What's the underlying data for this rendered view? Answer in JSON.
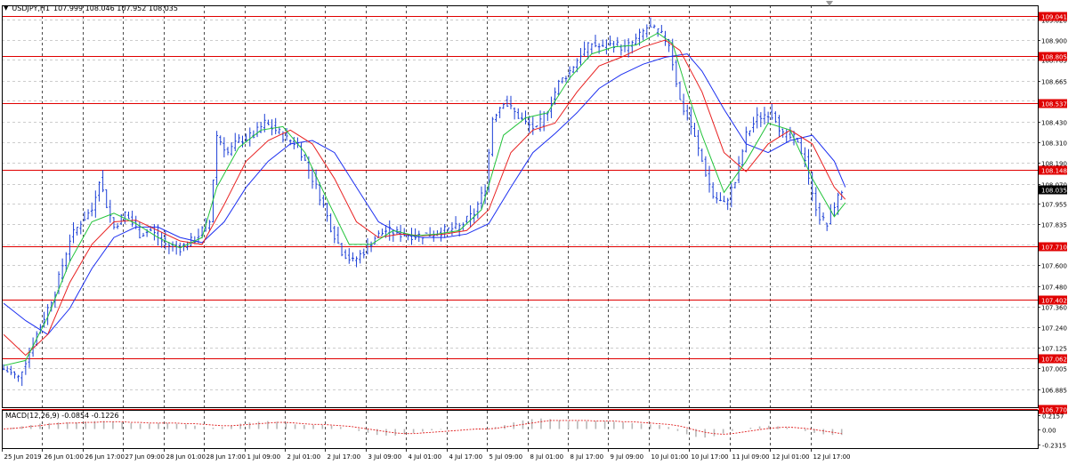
{
  "window": {
    "menu_icon": "triangle-down-icon",
    "symbol": "USDJPY,H1",
    "ohlc": "107.999 108.046 107.952 108.035"
  },
  "macd": {
    "label": "MACD(12,26,9) -0.0854 -0.1226",
    "ticks": [
      "0.2157",
      "0.00",
      "-0.2315"
    ],
    "tick_values": [
      0.2157,
      0.0,
      -0.2315
    ],
    "ylim": [
      -0.29,
      0.29
    ],
    "histogram": [
      0.0,
      0.02,
      0.04,
      0.06,
      0.08,
      0.09,
      0.1,
      0.1,
      0.1,
      0.11,
      0.12,
      0.12,
      0.11,
      0.1,
      0.09,
      0.08,
      0.08,
      0.09,
      0.09,
      0.08,
      0.07,
      0.05,
      0.03,
      0.02,
      0.03,
      0.05,
      0.08,
      0.1,
      0.11,
      0.12,
      0.11,
      0.09,
      0.07,
      0.06,
      0.06,
      0.06,
      0.05,
      0.03,
      0.0,
      -0.03,
      -0.06,
      -0.09,
      -0.1,
      -0.1,
      -0.08,
      -0.06,
      -0.04,
      -0.02,
      -0.01,
      0.0,
      0.0,
      0.0,
      0.0,
      0.01,
      0.03,
      0.06,
      0.1,
      0.13,
      0.15,
      0.16,
      0.15,
      0.13,
      0.12,
      0.12,
      0.12,
      0.12,
      0.12,
      0.11,
      0.1,
      0.09,
      0.08,
      0.07,
      0.06,
      0.03,
      -0.03,
      -0.08,
      -0.12,
      -0.13,
      -0.11,
      -0.07,
      -0.03,
      0.0,
      0.02,
      0.04,
      0.05,
      0.04,
      0.02,
      0.0,
      -0.03,
      -0.06,
      -0.08,
      -0.09,
      -0.09
    ],
    "signal": [
      0.0,
      0.01,
      0.02,
      0.04,
      0.05,
      0.07,
      0.08,
      0.09,
      0.09,
      0.1,
      0.1,
      0.11,
      0.11,
      0.11,
      0.1,
      0.1,
      0.09,
      0.09,
      0.09,
      0.09,
      0.08,
      0.08,
      0.07,
      0.06,
      0.05,
      0.05,
      0.06,
      0.07,
      0.08,
      0.09,
      0.1,
      0.1,
      0.09,
      0.08,
      0.07,
      0.07,
      0.06,
      0.05,
      0.04,
      0.02,
      0.0,
      -0.02,
      -0.04,
      -0.06,
      -0.07,
      -0.07,
      -0.06,
      -0.05,
      -0.04,
      -0.03,
      -0.02,
      -0.01,
      0.0,
      0.0,
      0.01,
      0.03,
      0.05,
      0.07,
      0.09,
      0.11,
      0.13,
      0.13,
      0.13,
      0.13,
      0.13,
      0.12,
      0.12,
      0.12,
      0.11,
      0.11,
      0.1,
      0.09,
      0.08,
      0.07,
      0.05,
      0.02,
      -0.02,
      -0.05,
      -0.07,
      -0.08,
      -0.07,
      -0.05,
      -0.03,
      -0.01,
      0.01,
      0.02,
      0.03,
      0.02,
      0.01,
      -0.01,
      -0.03,
      -0.05,
      -0.07
    ]
  },
  "chart_data": {
    "type": "candlestick",
    "symbol": "USDJPY",
    "timeframe": "H1",
    "ylim": [
      106.78,
      109.1
    ],
    "yticks": [
      "109.020",
      "108.900",
      "108.785",
      "108.665",
      "108.550",
      "108.430",
      "108.310",
      "108.190",
      "108.070",
      "107.955",
      "107.835",
      "107.720",
      "107.600",
      "107.480",
      "107.360",
      "107.240",
      "107.125",
      "107.005",
      "106.885"
    ],
    "ytick_values": [
      109.02,
      108.9,
      108.785,
      108.665,
      108.55,
      108.43,
      108.31,
      108.19,
      108.07,
      107.955,
      107.835,
      107.72,
      107.6,
      107.48,
      107.36,
      107.24,
      107.125,
      107.005,
      106.885
    ],
    "xticks": [
      "25 Jun 2019",
      "26 Jun 01:00",
      "26 Jun 17:00",
      "27 Jun 09:00",
      "28 Jun 01:00",
      "28 Jun 17:00",
      "1 Jul 09:00",
      "2 Jul 01:00",
      "2 Jul 17:00",
      "3 Jul 09:00",
      "4 Jul 01:00",
      "4 Jul 17:00",
      "5 Jul 09:00",
      "8 Jul 01:00",
      "8 Jul 17:00",
      "9 Jul 09:00",
      "10 Jul 01:00",
      "10 Jul 17:00",
      "11 Jul 09:00",
      "12 Jul 01:00",
      "12 Jul 17:00"
    ],
    "xtick_bars": [
      0,
      11,
      22,
      33,
      44,
      55,
      66,
      77,
      88,
      99,
      110,
      121,
      132,
      143,
      154,
      165,
      176,
      187,
      198,
      209,
      220
    ],
    "bar_count": 229,
    "horizontal_levels": [
      {
        "value": 109.04,
        "label": "109.041"
      },
      {
        "value": 108.805,
        "label": "108.805"
      },
      {
        "value": 108.537,
        "label": "108.537"
      },
      {
        "value": 108.148,
        "label": "108.148"
      },
      {
        "value": 107.71,
        "label": "107.710"
      },
      {
        "value": 107.402,
        "label": "107.402"
      },
      {
        "value": 107.062,
        "label": "107.062"
      },
      {
        "value": 106.77,
        "label": "106.770"
      }
    ],
    "current_price": {
      "value": 108.035,
      "label": "108.035"
    },
    "price_path": [
      [
        0,
        107.0
      ],
      [
        4,
        106.95
      ],
      [
        8,
        107.15
      ],
      [
        11,
        107.3
      ],
      [
        14,
        107.45
      ],
      [
        18,
        107.75
      ],
      [
        21,
        107.85
      ],
      [
        24,
        107.92
      ],
      [
        26,
        108.1
      ],
      [
        28,
        107.95
      ],
      [
        30,
        107.82
      ],
      [
        33,
        107.9
      ],
      [
        37,
        107.78
      ],
      [
        40,
        107.8
      ],
      [
        44,
        107.72
      ],
      [
        48,
        107.7
      ],
      [
        52,
        107.75
      ],
      [
        56,
        107.85
      ],
      [
        58,
        108.35
      ],
      [
        61,
        108.25
      ],
      [
        64,
        108.32
      ],
      [
        68,
        108.35
      ],
      [
        71,
        108.42
      ],
      [
        74,
        108.38
      ],
      [
        77,
        108.33
      ],
      [
        80,
        108.3
      ],
      [
        83,
        108.15
      ],
      [
        86,
        108.0
      ],
      [
        89,
        107.82
      ],
      [
        92,
        107.68
      ],
      [
        95,
        107.62
      ],
      [
        98,
        107.68
      ],
      [
        101,
        107.76
      ],
      [
        104,
        107.8
      ],
      [
        108,
        107.78
      ],
      [
        112,
        107.77
      ],
      [
        116,
        107.78
      ],
      [
        120,
        107.8
      ],
      [
        124,
        107.82
      ],
      [
        128,
        107.9
      ],
      [
        131,
        108.05
      ],
      [
        133,
        108.45
      ],
      [
        136,
        108.55
      ],
      [
        139,
        108.48
      ],
      [
        142,
        108.42
      ],
      [
        145,
        108.38
      ],
      [
        148,
        108.5
      ],
      [
        151,
        108.65
      ],
      [
        154,
        108.72
      ],
      [
        157,
        108.82
      ],
      [
        160,
        108.88
      ],
      [
        163,
        108.85
      ],
      [
        166,
        108.88
      ],
      [
        169,
        108.85
      ],
      [
        172,
        108.9
      ],
      [
        175,
        108.97
      ],
      [
        178,
        108.95
      ],
      [
        181,
        108.88
      ],
      [
        184,
        108.55
      ],
      [
        187,
        108.4
      ],
      [
        190,
        108.2
      ],
      [
        193,
        108.0
      ],
      [
        196,
        107.95
      ],
      [
        199,
        108.08
      ],
      [
        202,
        108.35
      ],
      [
        205,
        108.45
      ],
      [
        208,
        108.48
      ],
      [
        210,
        108.45
      ],
      [
        212,
        108.35
      ],
      [
        215,
        108.33
      ],
      [
        218,
        108.22
      ],
      [
        220,
        108.0
      ],
      [
        222,
        107.88
      ],
      [
        224,
        107.83
      ],
      [
        226,
        107.95
      ],
      [
        228,
        108.03
      ]
    ],
    "ma_fast_path": [
      [
        0,
        107.02
      ],
      [
        6,
        107.05
      ],
      [
        12,
        107.3
      ],
      [
        18,
        107.62
      ],
      [
        24,
        107.85
      ],
      [
        30,
        107.9
      ],
      [
        36,
        107.84
      ],
      [
        42,
        107.76
      ],
      [
        48,
        107.7
      ],
      [
        54,
        107.76
      ],
      [
        58,
        108.05
      ],
      [
        64,
        108.28
      ],
      [
        70,
        108.38
      ],
      [
        76,
        108.4
      ],
      [
        82,
        108.25
      ],
      [
        88,
        107.98
      ],
      [
        94,
        107.72
      ],
      [
        100,
        107.72
      ],
      [
        106,
        107.8
      ],
      [
        112,
        107.77
      ],
      [
        118,
        107.78
      ],
      [
        124,
        107.8
      ],
      [
        130,
        107.92
      ],
      [
        136,
        108.35
      ],
      [
        142,
        108.45
      ],
      [
        148,
        108.48
      ],
      [
        154,
        108.68
      ],
      [
        160,
        108.82
      ],
      [
        166,
        108.86
      ],
      [
        172,
        108.87
      ],
      [
        178,
        108.94
      ],
      [
        182,
        108.88
      ],
      [
        186,
        108.6
      ],
      [
        190,
        108.35
      ],
      [
        196,
        108.02
      ],
      [
        202,
        108.2
      ],
      [
        208,
        108.42
      ],
      [
        214,
        108.38
      ],
      [
        220,
        108.1
      ],
      [
        226,
        107.88
      ],
      [
        229,
        107.96
      ]
    ],
    "ma_mid_path": [
      [
        0,
        107.2
      ],
      [
        6,
        107.08
      ],
      [
        12,
        107.2
      ],
      [
        18,
        107.5
      ],
      [
        24,
        107.72
      ],
      [
        30,
        107.85
      ],
      [
        36,
        107.86
      ],
      [
        42,
        107.8
      ],
      [
        48,
        107.74
      ],
      [
        54,
        107.72
      ],
      [
        60,
        107.95
      ],
      [
        66,
        108.2
      ],
      [
        72,
        108.32
      ],
      [
        78,
        108.38
      ],
      [
        84,
        108.3
      ],
      [
        90,
        108.1
      ],
      [
        96,
        107.85
      ],
      [
        102,
        107.76
      ],
      [
        108,
        107.78
      ],
      [
        114,
        107.77
      ],
      [
        120,
        107.78
      ],
      [
        126,
        107.8
      ],
      [
        132,
        107.92
      ],
      [
        138,
        108.25
      ],
      [
        144,
        108.38
      ],
      [
        150,
        108.42
      ],
      [
        156,
        108.6
      ],
      [
        162,
        108.75
      ],
      [
        168,
        108.8
      ],
      [
        174,
        108.86
      ],
      [
        180,
        108.9
      ],
      [
        184,
        108.84
      ],
      [
        190,
        108.6
      ],
      [
        196,
        108.25
      ],
      [
        202,
        108.14
      ],
      [
        208,
        108.3
      ],
      [
        214,
        108.38
      ],
      [
        220,
        108.3
      ],
      [
        226,
        108.05
      ],
      [
        229,
        107.98
      ]
    ],
    "ma_slow_path": [
      [
        0,
        107.38
      ],
      [
        6,
        107.28
      ],
      [
        12,
        107.2
      ],
      [
        18,
        107.35
      ],
      [
        24,
        107.58
      ],
      [
        30,
        107.76
      ],
      [
        36,
        107.82
      ],
      [
        42,
        107.82
      ],
      [
        48,
        107.76
      ],
      [
        54,
        107.73
      ],
      [
        60,
        107.85
      ],
      [
        66,
        108.05
      ],
      [
        72,
        108.2
      ],
      [
        78,
        108.3
      ],
      [
        84,
        108.32
      ],
      [
        90,
        108.25
      ],
      [
        96,
        108.05
      ],
      [
        102,
        107.85
      ],
      [
        108,
        107.78
      ],
      [
        114,
        107.76
      ],
      [
        120,
        107.76
      ],
      [
        126,
        107.78
      ],
      [
        132,
        107.84
      ],
      [
        138,
        108.05
      ],
      [
        144,
        108.25
      ],
      [
        150,
        108.36
      ],
      [
        156,
        108.48
      ],
      [
        162,
        108.62
      ],
      [
        168,
        108.7
      ],
      [
        174,
        108.76
      ],
      [
        180,
        108.8
      ],
      [
        186,
        108.82
      ],
      [
        190,
        108.72
      ],
      [
        196,
        108.5
      ],
      [
        202,
        108.3
      ],
      [
        208,
        108.25
      ],
      [
        214,
        108.32
      ],
      [
        220,
        108.35
      ],
      [
        226,
        108.2
      ],
      [
        229,
        108.05
      ]
    ]
  }
}
